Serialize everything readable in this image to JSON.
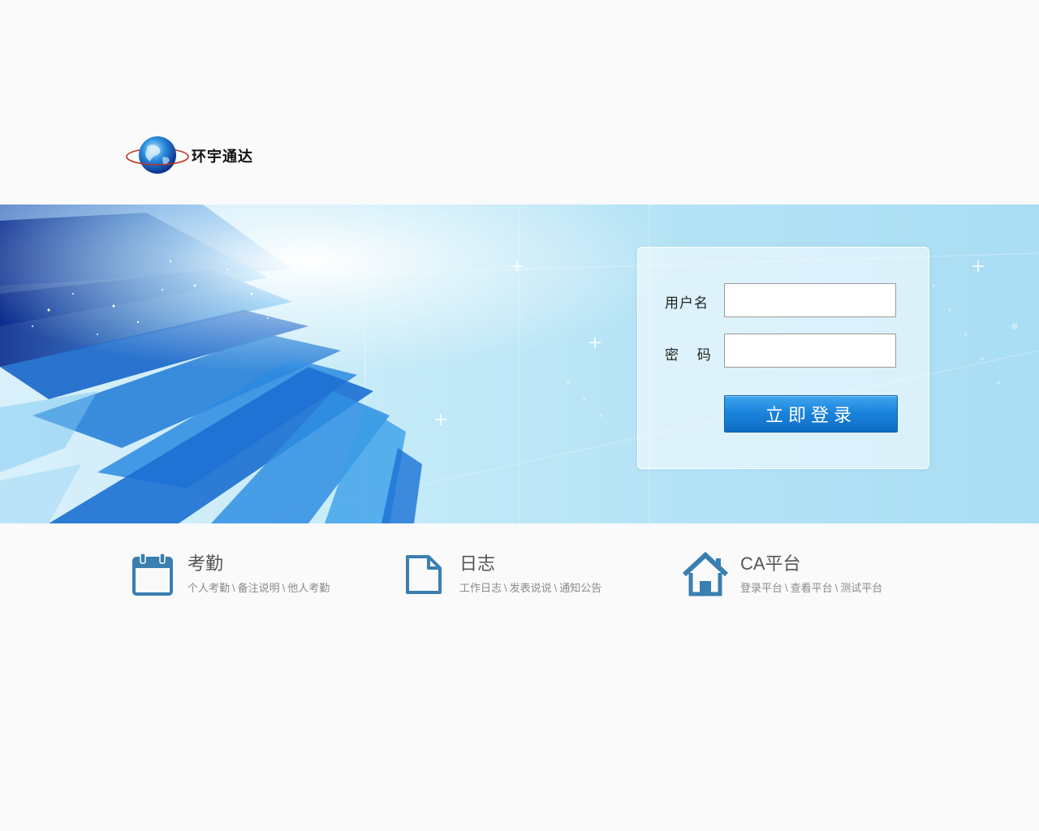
{
  "logo": {
    "text": "环宇通达"
  },
  "login": {
    "username_label": "用户名",
    "password_label": "密 码",
    "username_value": "",
    "password_value": "",
    "submit_label": "立即登录"
  },
  "features": [
    {
      "title": "考勤",
      "icon": "calendar-icon",
      "links": [
        "个人考勤",
        "备注说明",
        "他人考勤"
      ]
    },
    {
      "title": "日志",
      "icon": "document-icon",
      "links": [
        "工作日志",
        "发表说说",
        "通知公告"
      ]
    },
    {
      "title": "CA平台",
      "icon": "home-icon",
      "links": [
        "登录平台",
        "查看平台",
        "测试平台"
      ]
    }
  ],
  "separator": "\\",
  "colors": {
    "accent": "#1b84dc",
    "icon": "#3a7fb0",
    "background": "#fafafa"
  }
}
